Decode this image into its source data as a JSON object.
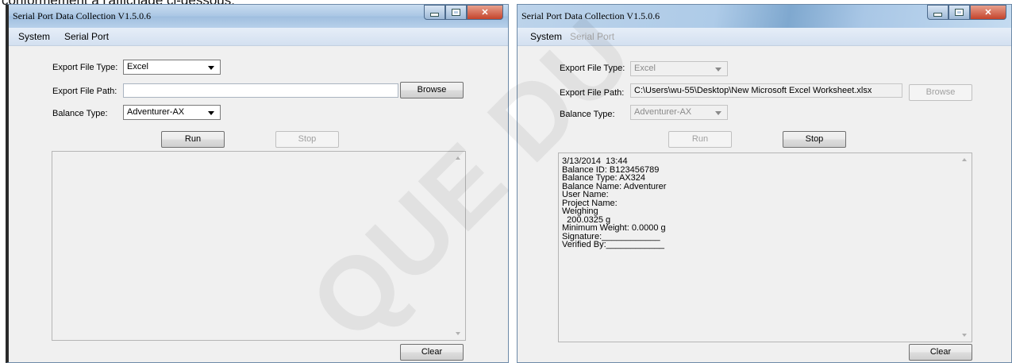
{
  "document_text": "conformément à l'affichage ci-dessous.",
  "watermark_text": "QUE DU",
  "left_window": {
    "title": "Serial Port Data Collection  V1.5.0.6",
    "menu": [
      "System",
      "Serial Port"
    ],
    "export_file_type_label": "Export File Type:",
    "export_file_type_value": "Excel",
    "export_file_path_label": "Export File Path:",
    "export_file_path_value": "",
    "browse_label": "Browse",
    "balance_type_label": "Balance Type:",
    "balance_type_value": "Adventurer-AX",
    "run_label": "Run",
    "stop_label": "Stop",
    "clear_label": "Clear"
  },
  "right_window": {
    "title": "Serial Port Data Collection  V1.5.0.6",
    "menu": [
      "System",
      "Serial Port"
    ],
    "export_file_type_label": "Export File Type:",
    "export_file_type_value": "Excel",
    "export_file_path_label": "Export File Path:",
    "export_file_path_value": "C:\\Users\\wu-55\\Desktop\\New Microsoft Excel Worksheet.xlsx",
    "browse_label": "Browse",
    "balance_type_label": "Balance Type:",
    "balance_type_value": "Adventurer-AX",
    "run_label": "Run",
    "stop_label": "Stop",
    "clear_label": "Clear",
    "output_lines": [
      "3/13/2014  13:44",
      "Balance ID: B123456789",
      "Balance Type: AX324",
      "Balance Name: Adventurer",
      "User Name:",
      "Project Name:",
      "Weighing",
      "  200.0325 g",
      "Minimum Weight: 0.0000 g",
      "Signature:____________",
      "Verified By:____________"
    ]
  }
}
